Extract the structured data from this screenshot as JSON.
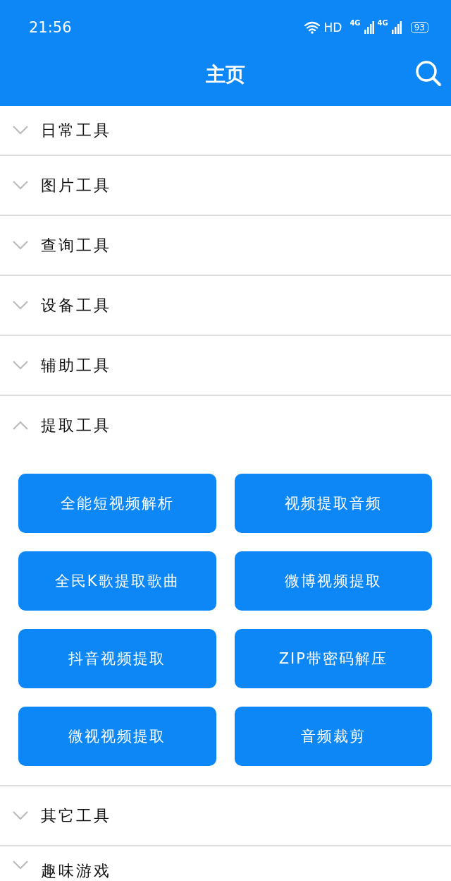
{
  "status_bar": {
    "time": "21:56",
    "hd": "HD",
    "sim_1": "4G",
    "sim_2": "4G",
    "battery": "93"
  },
  "app_bar": {
    "title": "主页"
  },
  "sections": [
    {
      "title": "日常工具",
      "expanded": false
    },
    {
      "title": "图片工具",
      "expanded": false
    },
    {
      "title": "查询工具",
      "expanded": false
    },
    {
      "title": "设备工具",
      "expanded": false
    },
    {
      "title": "辅助工具",
      "expanded": false
    },
    {
      "title": "提取工具",
      "expanded": true,
      "tools": [
        "全能短视频解析",
        "视频提取音频",
        "全民K歌提取歌曲",
        "微博视频提取",
        "抖音视频提取",
        "ZIP带密码解压",
        "微视视频提取",
        "音频裁剪"
      ]
    },
    {
      "title": "其它工具",
      "expanded": false
    },
    {
      "title": "趣味游戏",
      "expanded": false
    }
  ]
}
